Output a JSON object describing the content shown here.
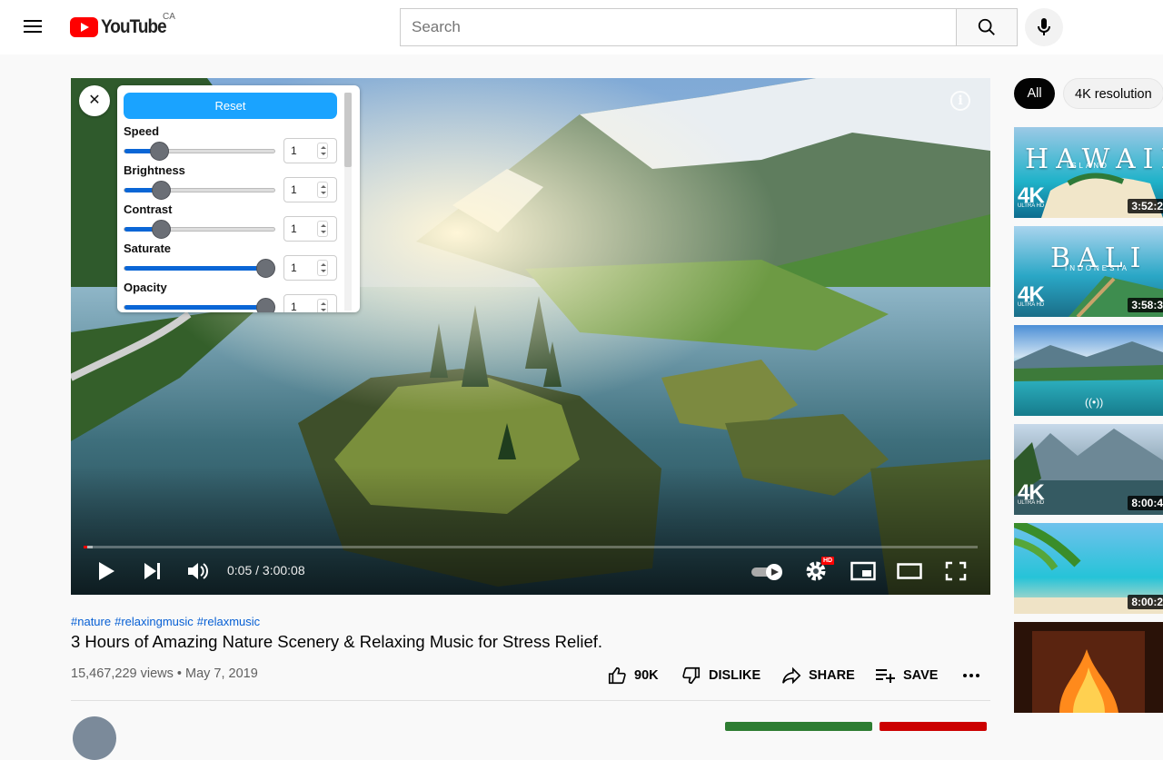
{
  "header": {
    "logo_text": "YouTube",
    "country": "CA",
    "search_placeholder": "Search"
  },
  "player": {
    "time": "0:05 / 3:00:08",
    "hd_badge": "HD",
    "info_glyph": "i",
    "progress_fraction": 0.0003,
    "loaded_fraction": 0.01
  },
  "panel": {
    "close_glyph": "✕",
    "reset_label": "Reset",
    "controls": [
      {
        "label": "Speed",
        "value": "1",
        "slider_fraction": 0.23
      },
      {
        "label": "Brightness",
        "value": "1",
        "slider_fraction": 0.24
      },
      {
        "label": "Contrast",
        "value": "1",
        "slider_fraction": 0.24
      },
      {
        "label": "Saturate",
        "value": "1",
        "slider_fraction": 0.94
      },
      {
        "label": "Opacity",
        "value": "1",
        "slider_fraction": 0.94
      }
    ]
  },
  "video": {
    "hashtags": [
      "#nature",
      "#relaxingmusic",
      "#relaxmusic"
    ],
    "title": "3 Hours of Amazing Nature Scenery & Relaxing Music for Stress Relief.",
    "views_date": "15,467,229 views • May 7, 2019",
    "likes": "90K",
    "dislike_label": "DISLIKE",
    "share_label": "SHARE",
    "save_label": "SAVE"
  },
  "sidebar": {
    "chips": [
      "All",
      "4K resolution"
    ],
    "thumbnails": [
      {
        "title_art": "HAWAII",
        "subtitle_art": "ISLAND",
        "badge": "4K",
        "badge_sub": "ULTRA HD",
        "duration": "3:52:2"
      },
      {
        "title_art": "BALI",
        "subtitle_art": "INDONESIA",
        "badge": "4K",
        "badge_sub": "ULTRA HD",
        "duration": "3:58:3"
      },
      {
        "title_art": "",
        "subtitle_art": "",
        "badge": "",
        "badge_sub": "",
        "duration": "",
        "live_glyph": "((•))"
      },
      {
        "title_art": "",
        "subtitle_art": "",
        "badge": "4K",
        "badge_sub": "ULTRA HD",
        "duration": "8:00:4"
      },
      {
        "title_art": "",
        "subtitle_art": "",
        "badge": "",
        "badge_sub": "",
        "duration": "8:00:2"
      },
      {
        "title_art": "",
        "subtitle_art": "",
        "badge": "",
        "badge_sub": "",
        "duration": ""
      }
    ]
  },
  "colors": {
    "brand_red": "#ff0000",
    "link_blue": "#065fd4",
    "reset_blue": "#1aa3ff",
    "slider_blue": "#0a66d6"
  }
}
